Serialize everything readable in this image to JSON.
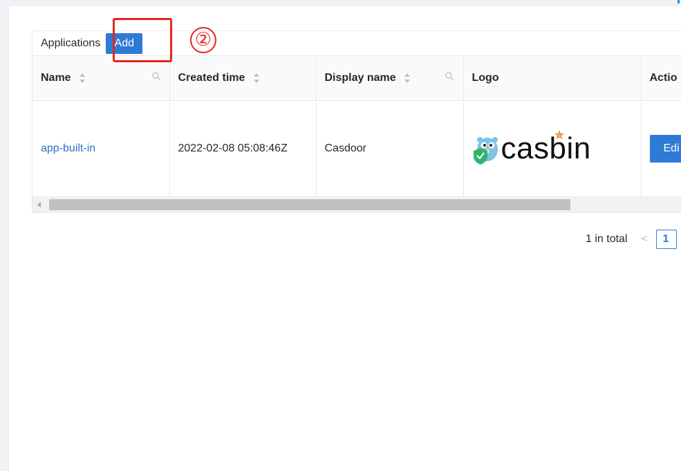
{
  "table": {
    "title": "Applications",
    "add_label": "Add",
    "columns": [
      {
        "label": "Name"
      },
      {
        "label": "Created time"
      },
      {
        "label": "Display name"
      },
      {
        "label": "Logo"
      },
      {
        "label": "Actio"
      }
    ],
    "rows": [
      {
        "name": "app-built-in",
        "created_time": "2022-02-08 05:08:46Z",
        "display_name": "Casdoor",
        "logo_text": "casbin",
        "action_label": "Edi"
      }
    ]
  },
  "annotation": {
    "step_number": "②"
  },
  "pagination": {
    "total_text": "1 in total",
    "prev_glyph": "<",
    "current_page": "1"
  },
  "colors": {
    "primary": "#2f7ad6",
    "annotation": "#e8231f",
    "link": "#2f6fc3"
  }
}
